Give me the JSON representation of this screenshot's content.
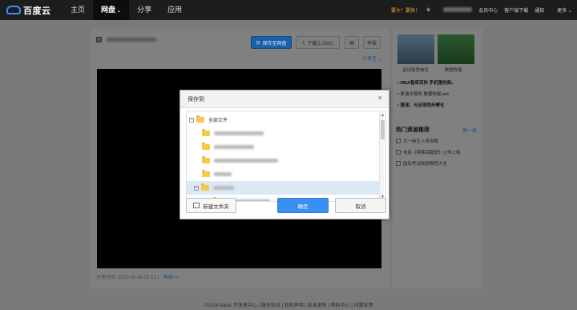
{
  "topbar": {
    "logo_text": "百度云",
    "nav": [
      "主页",
      "网盘",
      "分享",
      "应用"
    ],
    "vip": "要大！要快！",
    "links": [
      "会员中心",
      "客户端下载",
      "通知",
      "更多"
    ]
  },
  "toolbar": {
    "save_label": "保存至网盘",
    "download_label": "下载(1.32G)",
    "report_label": "举报",
    "share_to": "分享至"
  },
  "share_info": {
    "time": "分享时间: 2015-05-14 23:12",
    "report": "举报>>"
  },
  "sidebar": {
    "ad_captions": [
      "运动搞怪电位",
      "数据恢复"
    ],
    "ad_lines": [
      "MBA智库百科 手机里的商。",
      "原油交易所 数据恢复raid",
      "篮球，与足球同步孵化"
    ],
    "hot_title": "热门资源推荐",
    "hot_more": "换一换",
    "hot_items": [
      "大一新生入学攻略",
      "电影《钢客踩踏驶》火热上映",
      "国际考试视频教程大全"
    ]
  },
  "footer": "©2014 Baidu 开发者中心 | 服务协议 | 权利声明 | 版本更新 | 帮助中心 | 问题反馈",
  "dialog": {
    "title": "保存到",
    "root_label": "全部文件",
    "new_folder": "新建文件夹",
    "confirm": "确定",
    "cancel": "取消"
  },
  "colors": {
    "primary": "#3b8ff0",
    "topbar": "#1d1d1d",
    "folder": "#f5c94a"
  }
}
